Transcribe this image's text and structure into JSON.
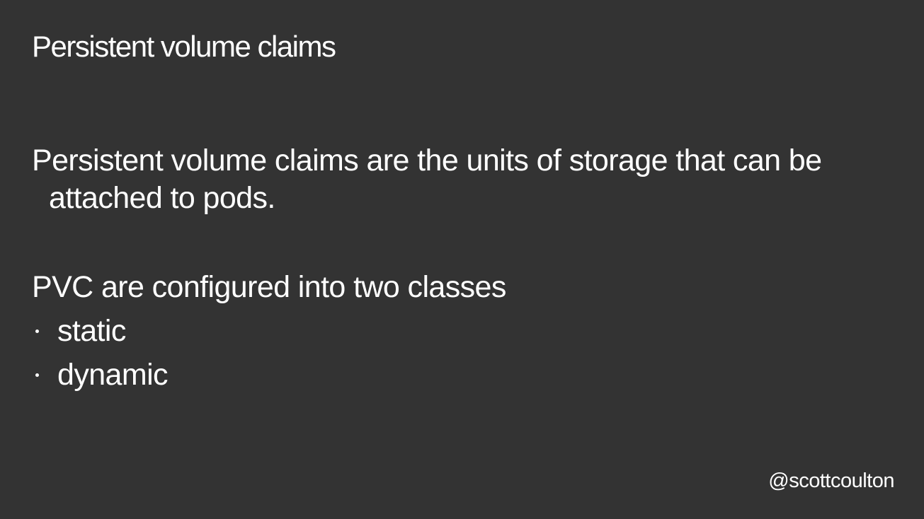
{
  "slide": {
    "title": "Persistent volume claims",
    "paragraph": "Persistent volume claims are the units of storage that can be attached to pods.",
    "subheading": "PVC are configured into two classes",
    "bullets": [
      {
        "label": "static"
      },
      {
        "label": "dynamic"
      }
    ],
    "handle": "@scottcoulton"
  },
  "colors": {
    "background": "#333333",
    "text": "#ffffff"
  }
}
